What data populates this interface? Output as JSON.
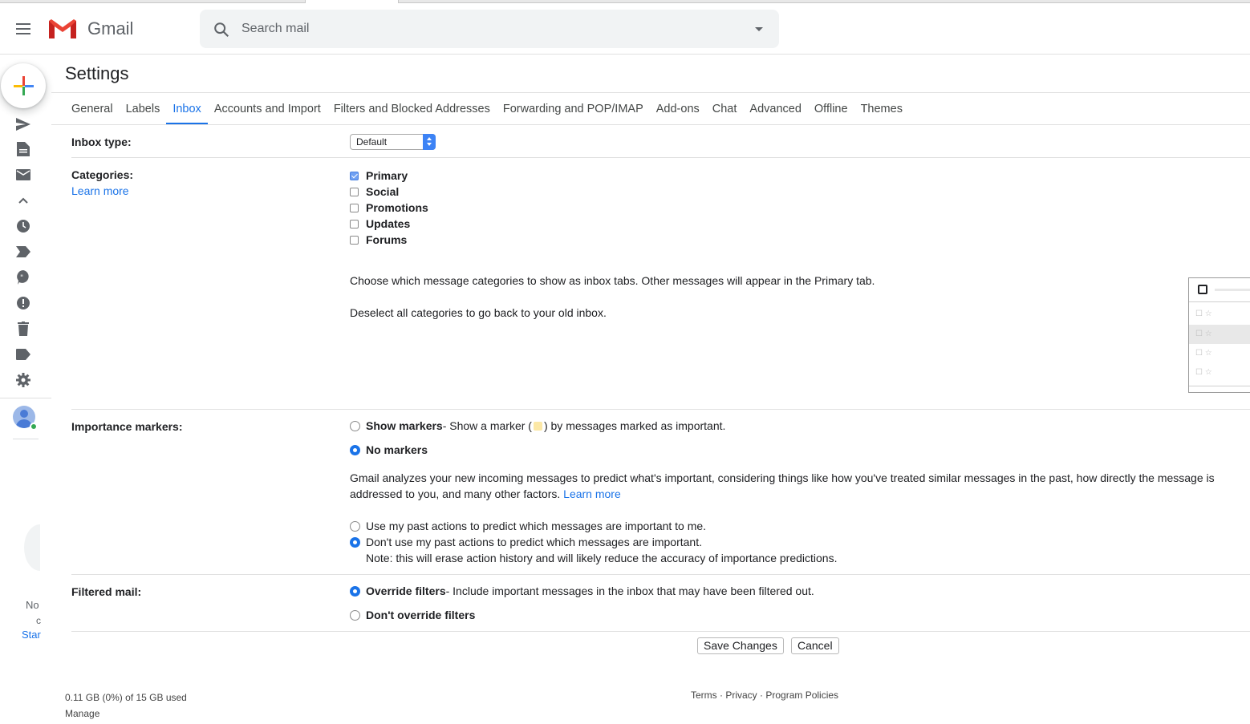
{
  "app": {
    "name": "Gmail"
  },
  "search": {
    "placeholder": "Search mail"
  },
  "settings": {
    "title": "Settings",
    "tabs": [
      {
        "label": "General",
        "active": false
      },
      {
        "label": "Labels",
        "active": false
      },
      {
        "label": "Inbox",
        "active": true
      },
      {
        "label": "Accounts and Import",
        "active": false
      },
      {
        "label": "Filters and Blocked Addresses",
        "active": false
      },
      {
        "label": "Forwarding and POP/IMAP",
        "active": false
      },
      {
        "label": "Add-ons",
        "active": false
      },
      {
        "label": "Chat",
        "active": false
      },
      {
        "label": "Advanced",
        "active": false
      },
      {
        "label": "Offline",
        "active": false
      },
      {
        "label": "Themes",
        "active": false
      }
    ]
  },
  "inbox_type": {
    "label": "Inbox type:",
    "value": "Default"
  },
  "categories": {
    "label": "Categories:",
    "learn_more": "Learn more",
    "items": [
      {
        "label": "Primary",
        "checked": true
      },
      {
        "label": "Social",
        "checked": false
      },
      {
        "label": "Promotions",
        "checked": false
      },
      {
        "label": "Updates",
        "checked": false
      },
      {
        "label": "Forums",
        "checked": false
      }
    ],
    "description": "Choose which message categories to show as inbox tabs. Other messages will appear in the Primary tab.",
    "deselect_note": "Deselect all categories to go back to your old inbox."
  },
  "importance": {
    "label": "Importance markers:",
    "show_markers": "Show markers",
    "show_markers_desc_before": " - Show a marker (",
    "show_markers_desc_after": ") by messages marked as important.",
    "no_markers": "No markers",
    "analysis_text": "Gmail analyzes your new incoming messages to predict what's important, considering things like how you've treated similar messages in the past, how directly the message is addressed to you, and many other factors.",
    "learn_more": "Learn more",
    "use_past_actions": "Use my past actions to predict which messages are important to me.",
    "dont_use_past_actions": "Don't use my past actions to predict which messages are important.",
    "erase_note": "Note: this will erase action history and will likely reduce the accuracy of importance predictions.",
    "selected_marker_option": "No markers",
    "selected_prediction_option": "Don't use my past actions"
  },
  "filtered_mail": {
    "label": "Filtered mail:",
    "override": "Override filters",
    "override_desc": " - Include important messages in the inbox that may have been filtered out.",
    "dont_override": "Don't override filters",
    "selected": "Override filters"
  },
  "actions": {
    "save": "Save Changes",
    "cancel": "Cancel"
  },
  "footer": {
    "storage": "0.11 GB (0%) of 15 GB used",
    "manage": "Manage",
    "terms": "Terms",
    "privacy": "Privacy",
    "policies": "Program Policies",
    "dot": " · "
  },
  "chat_panel": {
    "text_1": "No",
    "text_2": "c",
    "link": "Star"
  },
  "colors": {
    "accent": "#1a73e8",
    "marker": "#fce8a6",
    "online": "#34a853"
  }
}
